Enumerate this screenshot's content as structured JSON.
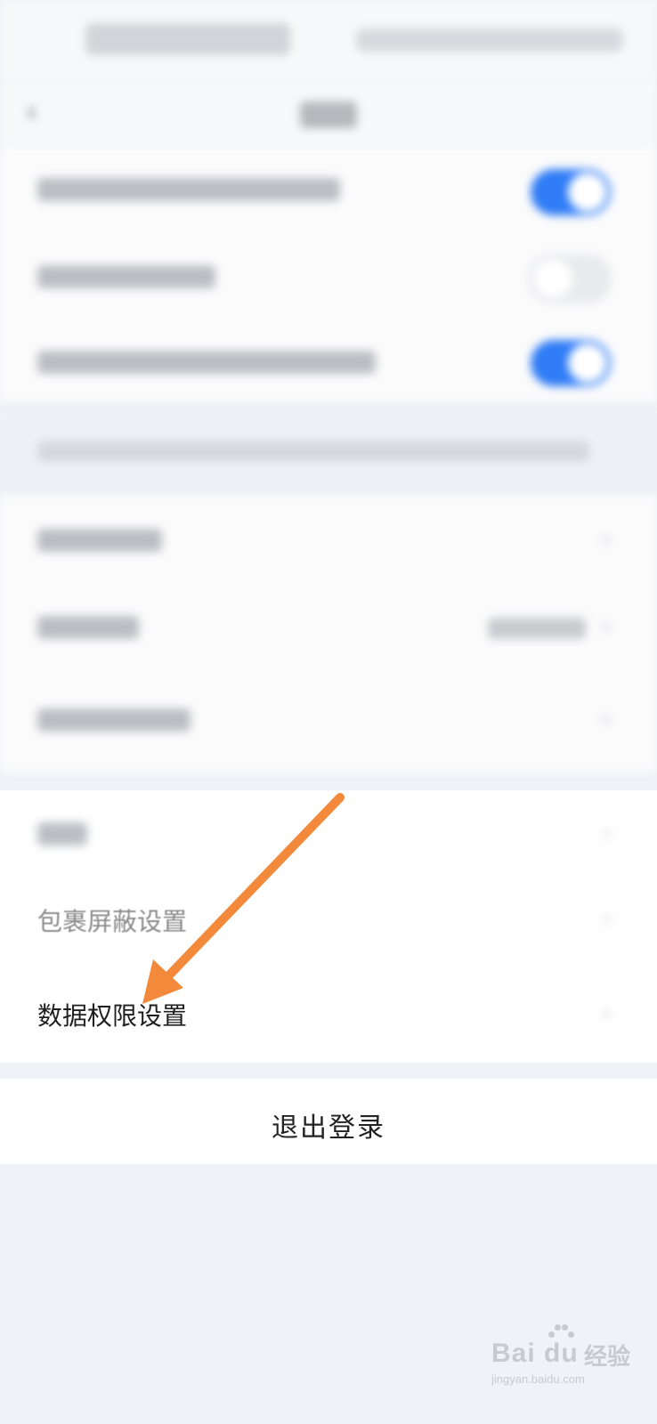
{
  "settings": {
    "note_hint": "",
    "items_visible": {
      "shield_package": "包裹屏蔽设置",
      "data_permission": "数据权限设置"
    },
    "logout_label": "退出登录"
  },
  "toggles": {
    "row1_on": true,
    "row2_on": false,
    "row3_on": true
  },
  "colors": {
    "toggle_on": "#2f7cf6",
    "arrow": "#f38a3b",
    "background": "#f0f2f7"
  },
  "icons": {
    "back": "back-chevron-icon",
    "chevron": "chevron-right-icon"
  },
  "watermark": {
    "logo": "Bai du",
    "cn": "经验",
    "url": "jingyan.baidu.com"
  }
}
